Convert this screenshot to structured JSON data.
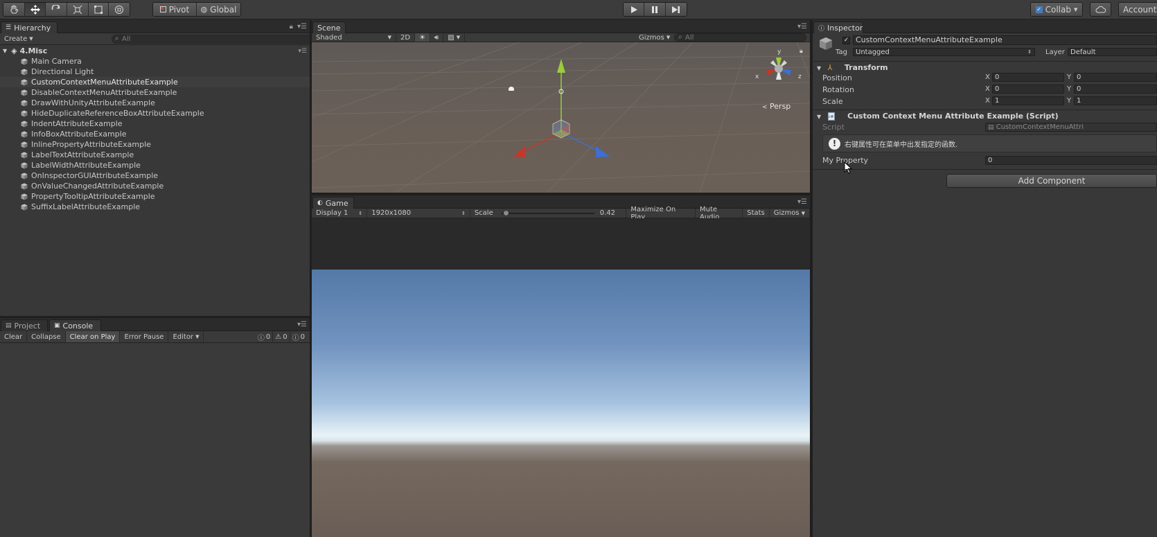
{
  "toolbar": {
    "tools": [
      "hand-tool-icon",
      "move-tool-icon",
      "rotate-tool-icon",
      "scale-tool-icon",
      "rect-tool-icon",
      "transform-tool-icon"
    ],
    "pivot_label": "Pivot",
    "global_label": "Global",
    "collab_label": "Collab",
    "account_label": "Account"
  },
  "hierarchy": {
    "tab_label": "Hierarchy",
    "create_label": "Create",
    "search_placeholder": "All",
    "scene_name": "4.Misc",
    "items": [
      "Main Camera",
      "Directional Light",
      "CustomContextMenuAttributeExample",
      "DisableContextMenuAttributeExample",
      "DrawWithUnityAttributeExample",
      "HideDuplicateReferenceBoxAttributeExample",
      "IndentAttributeExample",
      "InfoBoxAttributeExample",
      "InlinePropertyAttributeExample",
      "LabelTextAttributeExample",
      "LabelWidthAttributeExample",
      "OnInspectorGUIAttributeExample",
      "OnValueChangedAttributeExample",
      "PropertyTooltipAttributeExample",
      "SuffixLabelAttributeExample"
    ],
    "selected_index": 2
  },
  "console": {
    "tabs": [
      "Project",
      "Console"
    ],
    "buttons": [
      "Clear",
      "Collapse",
      "Clear on Play",
      "Error Pause",
      "Editor"
    ],
    "counts": {
      "log": "0",
      "warning": "0",
      "error": "0"
    }
  },
  "scene": {
    "tab_label": "Scene",
    "shading_mode": "Shaded",
    "mode_2d": "2D",
    "gizmos_label": "Gizmos",
    "search_placeholder": "All",
    "persp_label": "Persp",
    "axis_labels": {
      "x": "x",
      "y": "y",
      "z": "z"
    }
  },
  "game": {
    "tab_label": "Game",
    "display": "Display 1",
    "resolution": "1920x1080",
    "scale_label": "Scale",
    "scale_value": "0.42",
    "scale_fraction": 0.02,
    "buttons": [
      "Maximize On Play",
      "Mute Audio",
      "Stats",
      "Gizmos"
    ]
  },
  "inspector": {
    "tab_label": "Inspector",
    "object_name": "CustomContextMenuAttributeExample",
    "tag_label": "Tag",
    "tag_value": "Untagged",
    "layer_label": "Layer",
    "layer_value": "Default",
    "transform": {
      "title": "Transform",
      "rows": [
        {
          "label": "Position",
          "x": "0",
          "y": "0"
        },
        {
          "label": "Rotation",
          "x": "0",
          "y": "0"
        },
        {
          "label": "Scale",
          "x": "1",
          "y": "1"
        }
      ],
      "x_axis": "X",
      "y_axis": "Y"
    },
    "script_component": {
      "title": "Custom Context Menu Attribute Example (Script)",
      "script_label": "Script",
      "script_value": "CustomContextMenuAttri",
      "info_text": "右键属性可在菜单中出发指定的函数.",
      "property_label": "My Property",
      "property_value": "0"
    },
    "add_component_label": "Add Component"
  },
  "colors": {
    "accent_blue": "#4a7ab8",
    "axis_x": "#c0392b",
    "axis_y": "#9ccc3c",
    "axis_z": "#3d6fd4"
  }
}
